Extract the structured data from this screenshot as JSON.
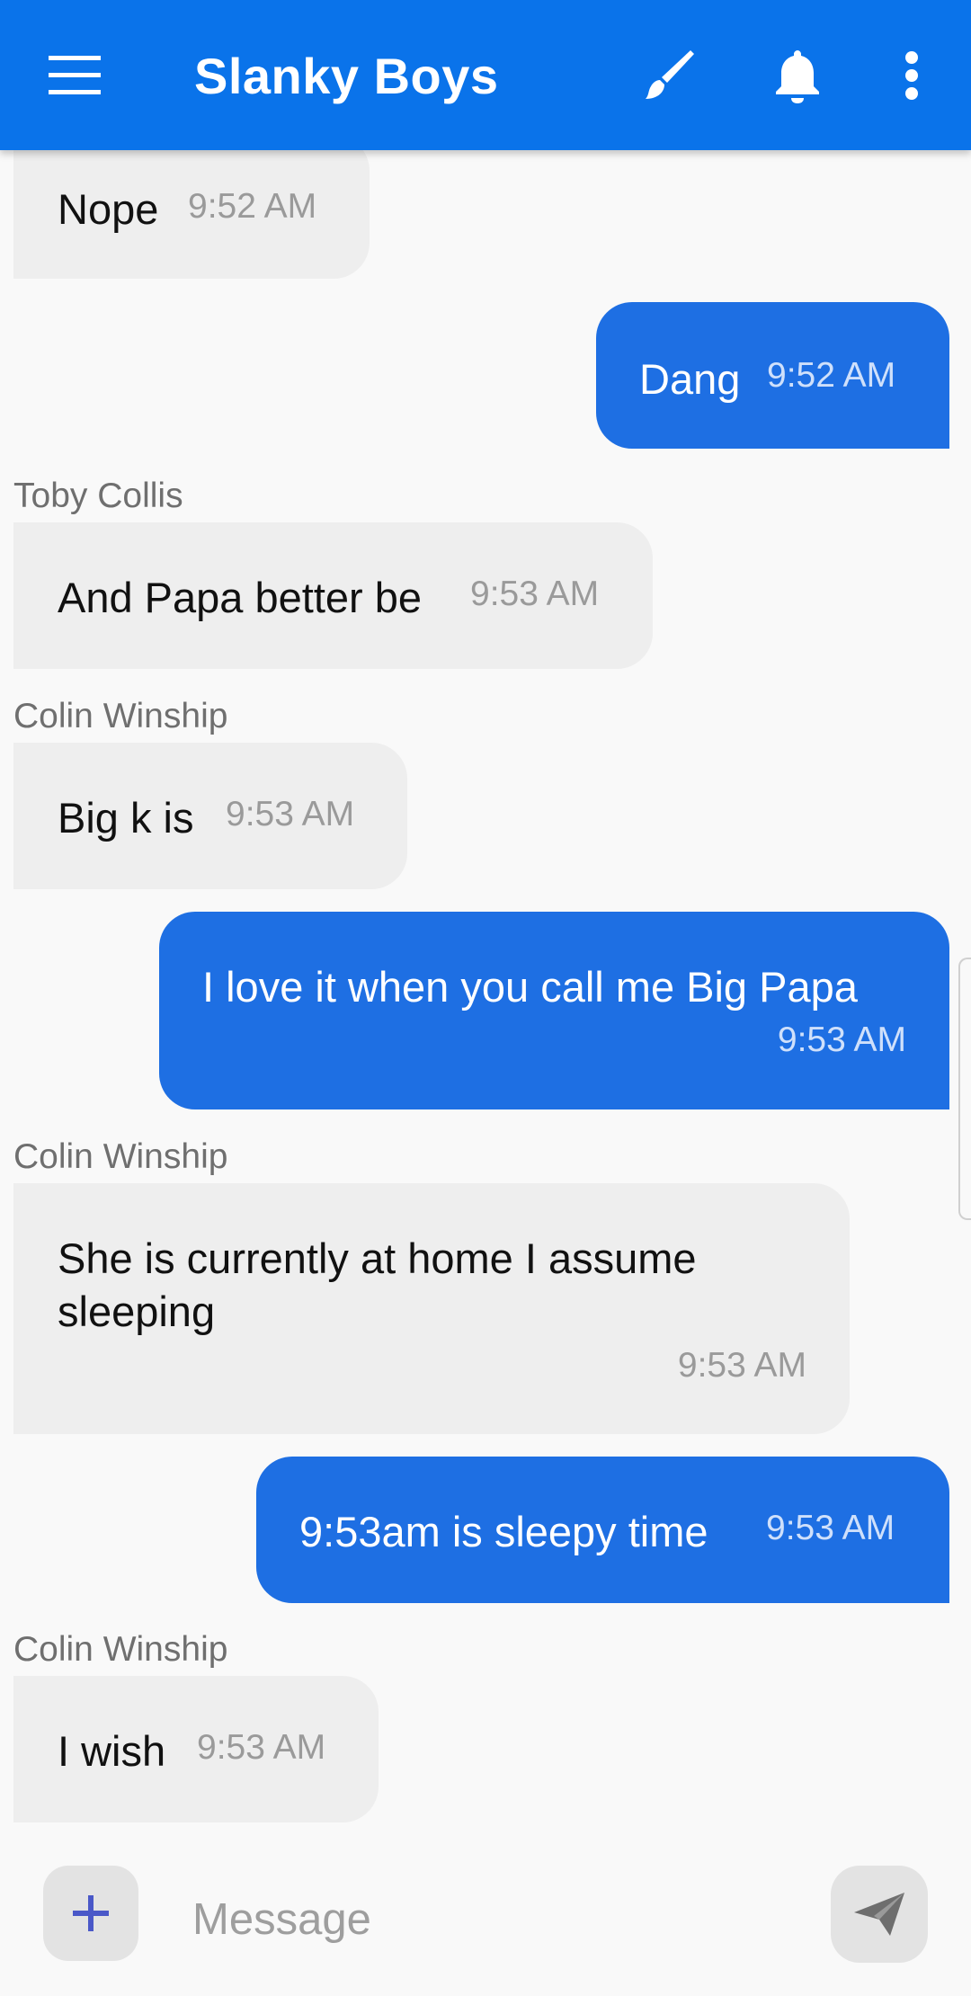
{
  "header": {
    "title": "Slanky Boys",
    "icons": [
      "menu-icon",
      "brush-icon",
      "bell-icon",
      "more-vert-icon"
    ],
    "color": "#0a73ea"
  },
  "messages": [
    {
      "direction": "in",
      "text": "Nope",
      "time": "9:52 AM"
    },
    {
      "direction": "out",
      "text": "Dang",
      "time": "9:52 AM"
    },
    {
      "direction": "in",
      "sender": "Toby Collis",
      "text": "And Papa better be",
      "time": "9:53 AM"
    },
    {
      "direction": "in",
      "sender": "Colin Winship",
      "text": "Big k is",
      "time": "9:53 AM"
    },
    {
      "direction": "out",
      "text": "I love it when you call me Big Papa",
      "time": "9:53 AM"
    },
    {
      "direction": "in",
      "sender": "Colin Winship",
      "text_line1": "She is currently at home I assume",
      "text_line2": "sleeping",
      "time": "9:53 AM"
    },
    {
      "direction": "out",
      "text": "9:53am is sleepy time",
      "time": "9:53 AM"
    },
    {
      "direction": "in",
      "sender": "Colin Winship",
      "text": "I wish",
      "time": "9:53 AM"
    }
  ],
  "composer": {
    "placeholder": "Message",
    "icons": [
      "add-icon",
      "send-icon"
    ]
  },
  "colors": {
    "outgoing_bubble": "#1e6fe3",
    "incoming_bubble": "#eeeeee"
  }
}
